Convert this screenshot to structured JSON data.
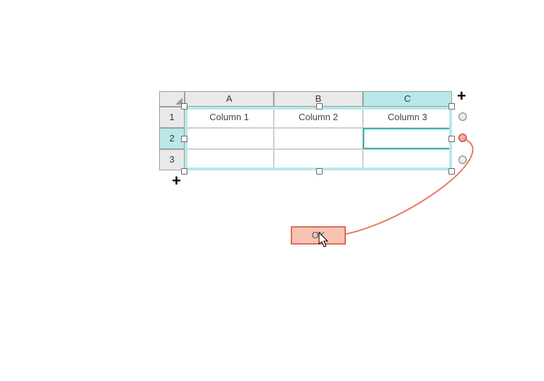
{
  "grid": {
    "columns": [
      "A",
      "B",
      "C"
    ],
    "rows": [
      "1",
      "2",
      "3"
    ],
    "headers": {
      "c1": "Column 1",
      "c2": "Column 2",
      "c3": "Column 3"
    },
    "active_cell": "C2",
    "selected_column": "C",
    "selected_row": "2"
  },
  "button": {
    "ok_label": "OK"
  },
  "colors": {
    "selection": "#b8e8e8",
    "active_border": "#2fb6b0",
    "ok_border": "#e06a55",
    "ok_fill": "#f8c3b5"
  }
}
